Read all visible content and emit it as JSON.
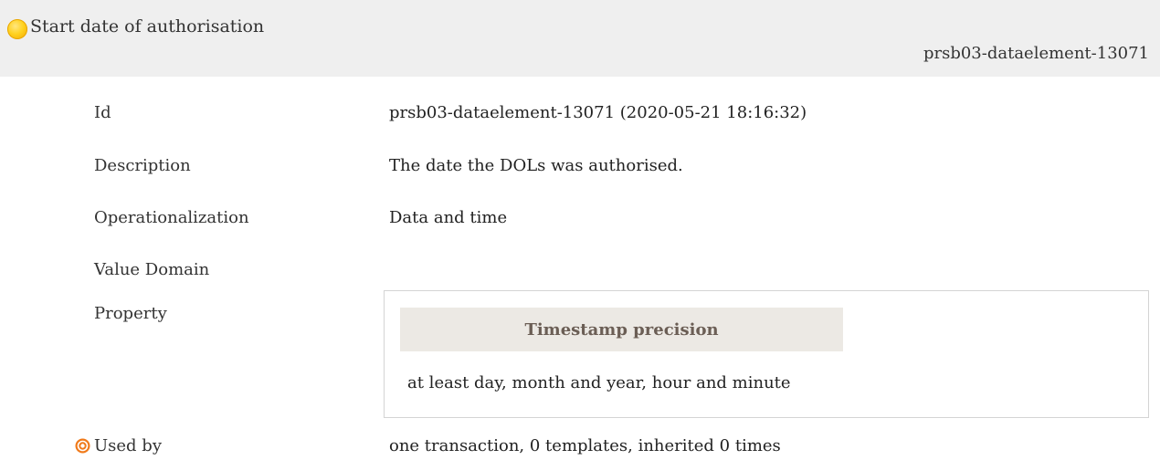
{
  "header": {
    "title": "Start date of authorisation",
    "element_id": "prsb03-dataelement-13071",
    "status_color": "#f5b400"
  },
  "rows": {
    "id": {
      "label": "Id",
      "value": "prsb03-dataelement-13071 (2020-05-21 18:16:32)"
    },
    "description": {
      "label": "Description",
      "value": "The date the DOLs was authorised."
    },
    "operationalization": {
      "label": "Operationalization",
      "value": "Data and time"
    },
    "value_domain": {
      "label": "Value Domain"
    },
    "property": {
      "label": "Property",
      "header": "Timestamp precision",
      "value": "at least day, month and year, hour and minute"
    },
    "used_by": {
      "label": "Used by",
      "value": "one transaction, 0 templates, inherited 0 times",
      "icon": "target-icon",
      "icon_color": "#f07a1a"
    }
  }
}
